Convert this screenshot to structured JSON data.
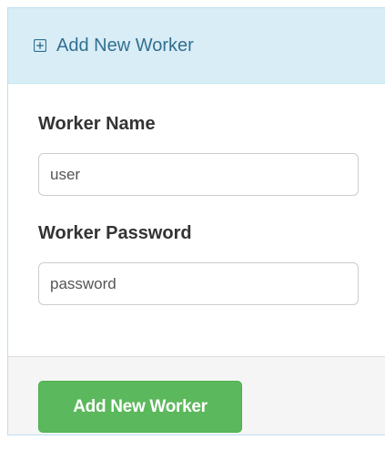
{
  "panel": {
    "heading": {
      "icon": "plus-square-icon",
      "title": "Add New Worker"
    },
    "fields": {
      "name": {
        "label": "Worker Name",
        "value": "user"
      },
      "password": {
        "label": "Worker Password",
        "value": "password"
      }
    },
    "footer": {
      "submit_label": "Add New Worker"
    }
  },
  "colors": {
    "heading_bg": "#d9edf7",
    "heading_text": "#31708f",
    "button_bg": "#5cb85c",
    "footer_bg": "#f5f5f5"
  }
}
